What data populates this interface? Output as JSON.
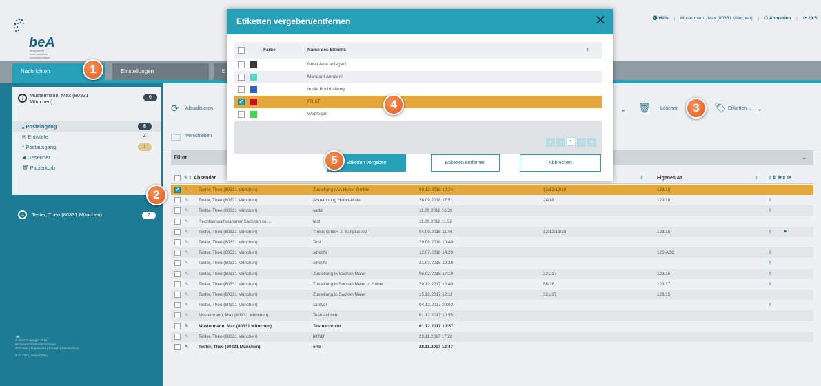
{
  "header": {
    "brand": "beA",
    "brand_sub": "besonderes elektronisches Anwaltspostfach",
    "nav": [
      "Hilfe",
      "Mustermann, Max (80331 München)",
      "Abmelden",
      "29:5"
    ]
  },
  "tabs": [
    {
      "label": "Nachrichten"
    },
    {
      "label": "Einstellungen"
    },
    {
      "label": "E"
    }
  ],
  "sidebar": {
    "account1": {
      "name": "Mustermann, Max (80331 München)",
      "count": "6"
    },
    "items": [
      {
        "label": "Posteingang",
        "count": "6"
      },
      {
        "label": "Entwürfe",
        "count": "4"
      },
      {
        "label": "Postausgang",
        "count": "1"
      },
      {
        "label": "Gesendet",
        "count": ""
      },
      {
        "label": "Papierkorb",
        "count": ""
      }
    ],
    "account2": {
      "name": "Tester, Theo (80331 München)",
      "count": "7"
    },
    "footer": [
      "© 2018 Copyright 2015",
      "Bundesrechtsanwaltskammer",
      "Startseite | Impressum | Kontakt | Datenschutz",
      "2.12.4875_Version(DE)"
    ]
  },
  "toolbar": {
    "refresh": "Aktualisieren",
    "move": "Verschieben",
    "delete": "Löschen",
    "labels": "Etiketten ..."
  },
  "filter": {
    "label": "Filter"
  },
  "table": {
    "col_sender": "Absender",
    "col_own_ref": "Eigenes Az.",
    "rows": [
      {
        "c1": "Tester, Theo (80331 München)",
        "c2": "Zustellung sAA Huber GmbH",
        "c3": "08.12.2018 10:24",
        "c4": "12/12/12/18",
        "c5": "123/18",
        "ex": "",
        "fl": "",
        "style": "sel"
      },
      {
        "c1": "Tester, Theo (80331 München)",
        "c2": "Abmahnung Huber-Maier",
        "c3": "26.09.2018 17:51",
        "c4": "24/18",
        "c5": "123/18",
        "ex": "!",
        "fl": "",
        "style": "odd"
      },
      {
        "c1": "Tester, Theo (80331 München)",
        "c2": "sadd",
        "c3": "11.09.2018 16:36",
        "c4": "",
        "c5": "",
        "ex": "!",
        "fl": "",
        "style": "alt"
      },
      {
        "c1": "Rechtsanwaltskammer Sachsen co ...",
        "c2": "test",
        "c3": "11.09.2018 11:58",
        "c4": "",
        "c5": "",
        "ex": "",
        "fl": "",
        "style": "odd"
      },
      {
        "c1": "Tester, Theo (80331 München)",
        "c2": "Tronik GmbH ./. Sanplus AG",
        "c3": "04.09.2018 11:46",
        "c4": "12/12/13/18",
        "c5": "123/15",
        "ex": "!",
        "fl": "⚑",
        "style": "alt"
      },
      {
        "c1": "Tester, Theo (80331 München)",
        "c2": "Test",
        "c3": "29.08.2018 10:40",
        "c4": "",
        "c5": "",
        "ex": "",
        "fl": "",
        "style": "odd"
      },
      {
        "c1": "Tester, Theo (80331 München)",
        "c2": "sdfesfe",
        "c3": "12.07.2018 14:20",
        "c4": "",
        "c5": "123-ABC",
        "ex": "!",
        "fl": "",
        "style": "alt"
      },
      {
        "c1": "Tester, Theo (80331 München)",
        "c2": "sdfesfe",
        "c3": "21.03.2018 19:28",
        "c4": "",
        "c5": "",
        "ex": "!",
        "fl": "",
        "style": "odd"
      },
      {
        "c1": "Tester, Theo (80331 München)",
        "c2": "Zustellung in Sachen Maier",
        "c3": "05.02.2018 17:19",
        "c4": "321/17",
        "c5": "123/15",
        "ex": "!",
        "fl": "",
        "style": "alt"
      },
      {
        "c1": "Tester, Theo (80331 München)",
        "c2": "Zustellung in Sachen Meier ./. Huber",
        "c3": "20.12.2017 10:40",
        "c4": "56-16",
        "c5": "123/17",
        "ex": "!",
        "fl": "",
        "style": "odd"
      },
      {
        "c1": "Tester, Theo (80331 München)",
        "c2": "Zustellung in Sachen Maier",
        "c3": "15.12.2017 12:11",
        "c4": "321/17",
        "c5": "123/15",
        "ex": "",
        "fl": "",
        "style": "alt"
      },
      {
        "c1": "Tester, Theo (80331 München)",
        "c2": "safever",
        "c3": "04.12.2017 20:03",
        "c4": "",
        "c5": "",
        "ex": "!",
        "fl": "",
        "style": "odd"
      },
      {
        "c1": "Mustermann, Max (80331 München)",
        "c2": "Testnachricht",
        "c3": "01.12.2017 10:55",
        "c4": "",
        "c5": "",
        "ex": "",
        "fl": "",
        "style": "alt"
      },
      {
        "c1": "Mustermann, Max (80331 München)",
        "c2": "Testnachricht",
        "c3": "01.12.2017 10:57",
        "c4": "",
        "c5": "",
        "ex": "",
        "fl": "",
        "style": "odd bold"
      },
      {
        "c1": "Tester, Theo (80331 München)",
        "c2": "jkhfdjf",
        "c3": "29.11.2017 17:28",
        "c4": "",
        "c5": "",
        "ex": "",
        "fl": "",
        "style": "alt"
      },
      {
        "c1": "Tester, Theo (80331 München)",
        "c2": "erfe",
        "c3": "28.11.2017 12:47",
        "c4": "",
        "c5": "",
        "ex": "",
        "fl": "",
        "style": "odd bold"
      }
    ]
  },
  "modal": {
    "title": "Etiketten vergeben/entfernen",
    "col_color": "Farbe",
    "col_name": "Name des Etiketts",
    "labels": [
      {
        "name": "Neue Akte anlegen!",
        "color": "#3a3a3a",
        "checked": false
      },
      {
        "name": "Mandant anrufen!",
        "color": "#5ad7c8",
        "checked": false
      },
      {
        "name": "In die Buchhaltung",
        "color": "#2a62d0",
        "checked": false
      },
      {
        "name": "FRIST",
        "color": "#c8102e",
        "checked": true
      },
      {
        "name": "Weglegen",
        "color": "#3ed84a",
        "checked": false
      }
    ],
    "pager_current": "1",
    "btn_assign": "Etiketten vergeben",
    "btn_remove": "Etiketten entfernen",
    "btn_cancel": "Abbrechen"
  },
  "badges": [
    "1",
    "2",
    "3",
    "4",
    "5"
  ],
  "colors": {
    "accent": "#27a0ba",
    "sidebar": "#1d7b93",
    "selected_row": "#e4a93a",
    "badge": "#e8682a"
  }
}
